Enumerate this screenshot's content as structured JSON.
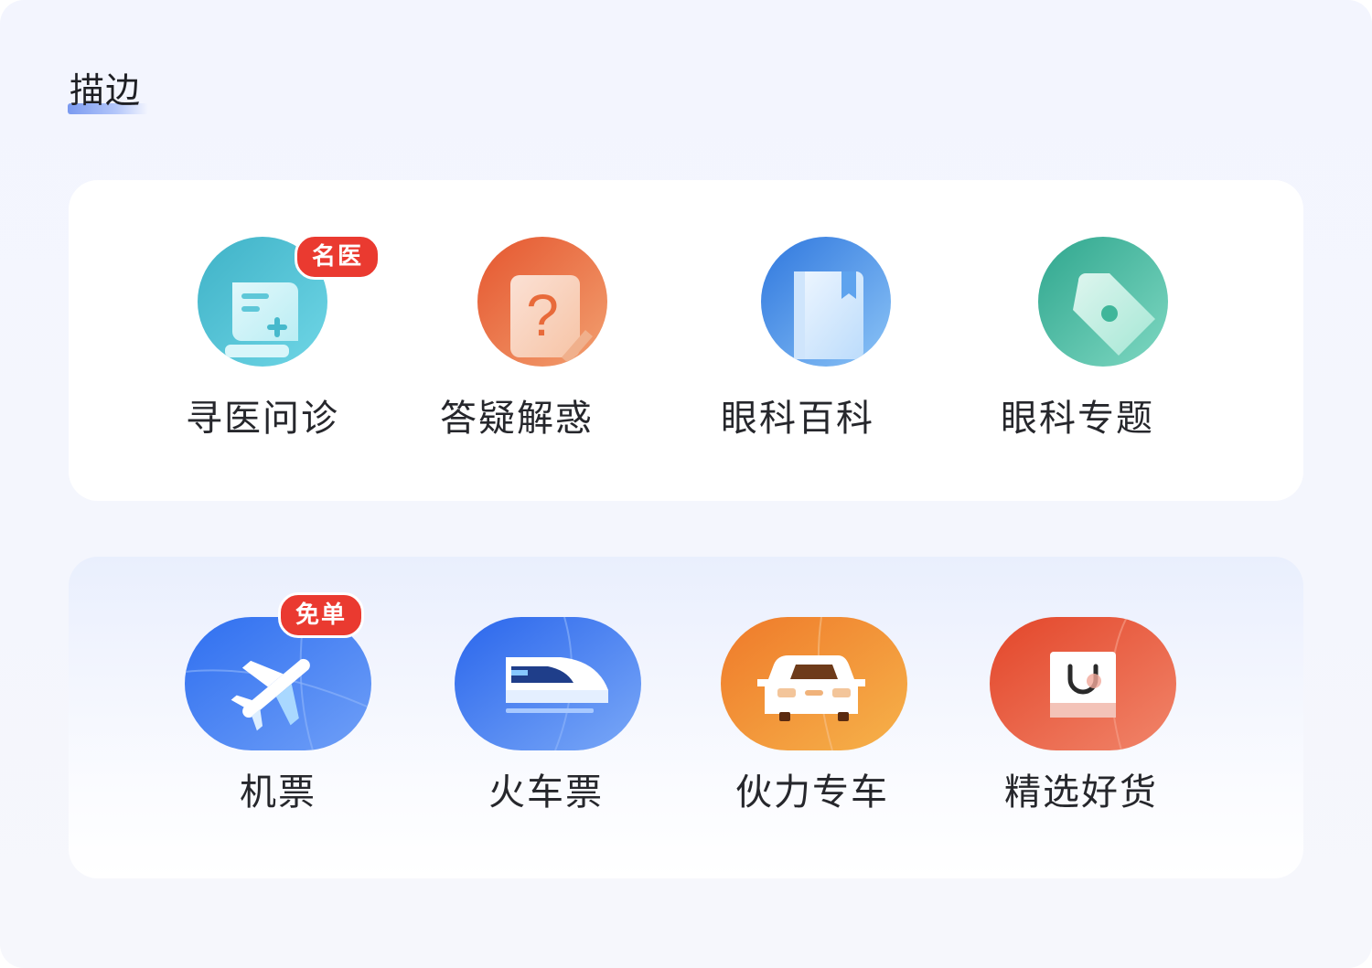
{
  "section": {
    "title": "描边"
  },
  "card_top": {
    "items": [
      {
        "label": "寻医问诊",
        "icon": "prescription-scroll-icon",
        "badge": "名医",
        "color": "#4cc3cf"
      },
      {
        "label": "答疑解惑",
        "icon": "question-note-icon",
        "badge": "",
        "color": "#ea6b3f"
      },
      {
        "label": "眼科百科",
        "icon": "book-icon",
        "badge": "",
        "color": "#3f8be6"
      },
      {
        "label": "眼科专题",
        "icon": "tag-icon",
        "badge": "",
        "color": "#3fb69a"
      }
    ]
  },
  "card_bottom": {
    "items": [
      {
        "label": "机票",
        "icon": "airplane-icon",
        "badge": "免单",
        "color": "#3d7af0"
      },
      {
        "label": "火车票",
        "icon": "train-icon",
        "badge": "",
        "color": "#3a74ee"
      },
      {
        "label": "伙力专车",
        "icon": "car-icon",
        "badge": "",
        "color": "#f08a2a"
      },
      {
        "label": "精选好货",
        "icon": "shopping-bag-icon",
        "badge": "",
        "color": "#e8522f"
      }
    ]
  },
  "colors": {
    "badge": "#ea3a30",
    "text": "#26272c",
    "title_accent": "#7a9af0"
  }
}
